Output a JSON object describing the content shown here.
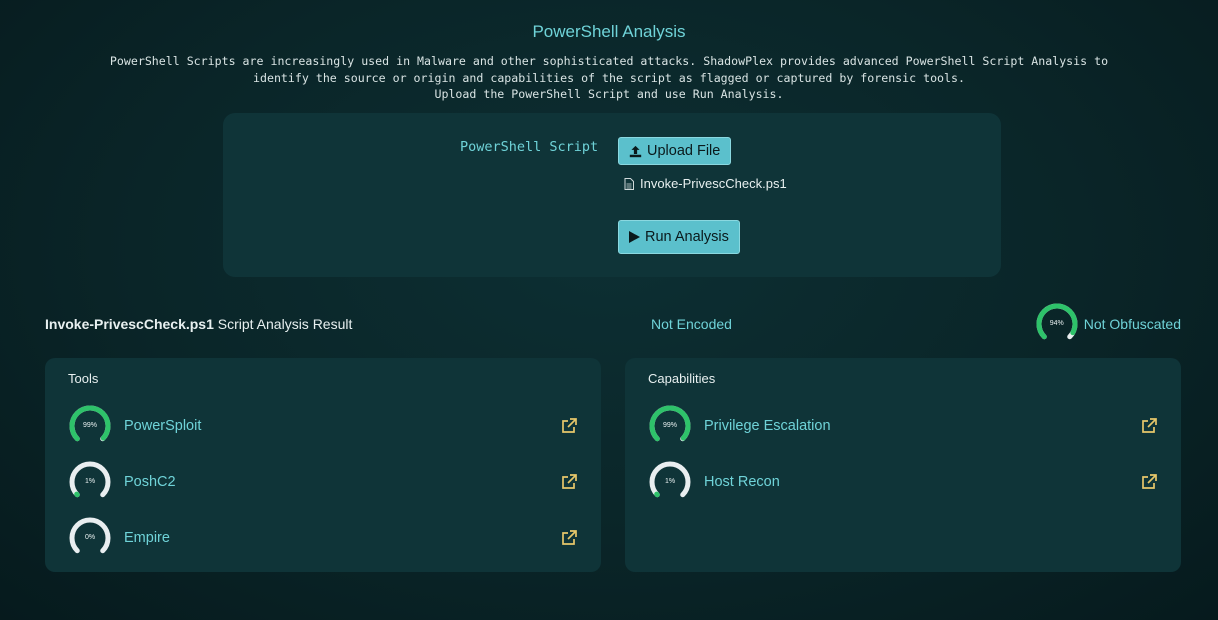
{
  "header": {
    "title": "PowerShell Analysis",
    "description_lines": [
      "PowerShell Scripts are increasingly used in Malware and other sophisticated attacks. ShadowPlex provides advanced PowerShell Script Analysis to",
      "identify the source or origin and capabilities of the script as flagged or captured by forensic tools.",
      "Upload the PowerShell Script and use Run Analysis."
    ]
  },
  "upload": {
    "label": "PowerShell Script",
    "upload_button": "Upload File",
    "file_name": "Invoke-PrivescCheck.ps1",
    "run_button": "Run Analysis"
  },
  "result": {
    "script_name": "Invoke-PrivescCheck.ps1",
    "title_suffix": " Script Analysis Result",
    "encoding_status": "Not Encoded",
    "obfuscation_status": "Not Obfuscated",
    "obfuscation_percent_label": "94%",
    "obfuscation_percent": 94
  },
  "tools": {
    "title": "Tools",
    "items": [
      {
        "name": "PowerSploit",
        "percent": 99,
        "percent_label": "99%"
      },
      {
        "name": "PoshC2",
        "percent": 1,
        "percent_label": "1%"
      },
      {
        "name": "Empire",
        "percent": 0,
        "percent_label": "0%"
      }
    ]
  },
  "capabilities": {
    "title": "Capabilities",
    "items": [
      {
        "name": "Privilege Escalation",
        "percent": 99,
        "percent_label": "99%"
      },
      {
        "name": "Host Recon",
        "percent": 1,
        "percent_label": "1%"
      }
    ]
  },
  "colors": {
    "accent": "#6fd3d8",
    "gauge_fill": "#2ec26a",
    "gauge_track": "#e9eef0",
    "link_icon": "#e7c76a",
    "button": "#5bc0cc"
  },
  "icons": {
    "upload": "upload-icon",
    "file": "file-icon",
    "run": "play-icon",
    "external_link": "external-link-icon"
  }
}
